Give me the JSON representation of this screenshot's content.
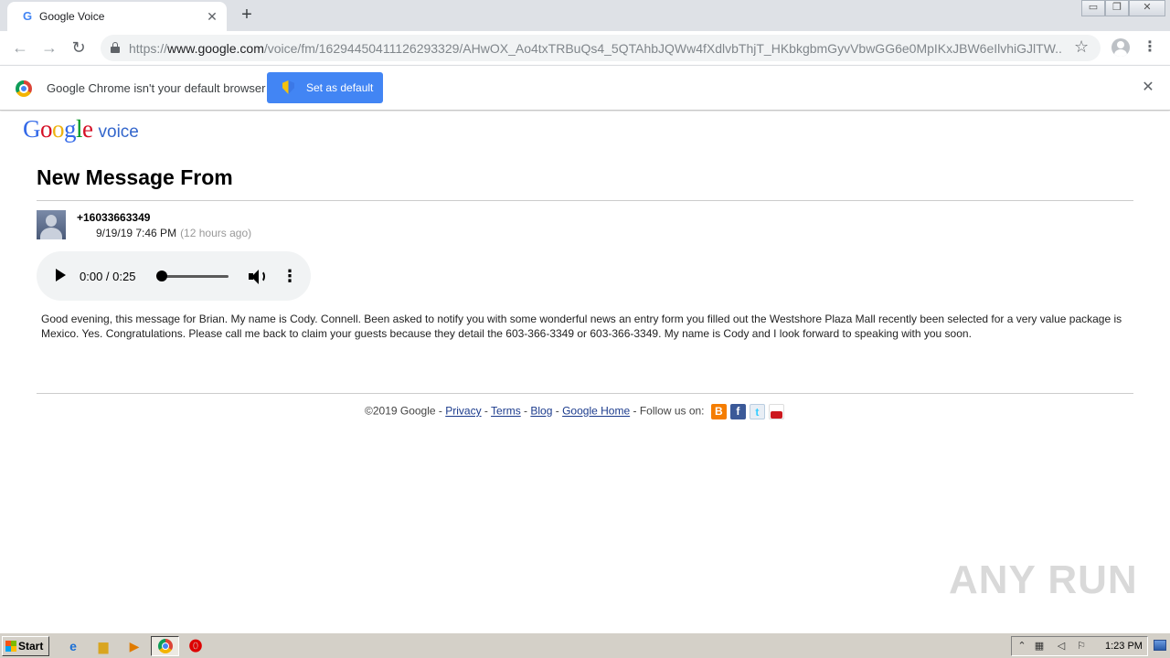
{
  "browser": {
    "tab_title": "Google Voice",
    "tab_favicon": "G",
    "url_scheme": "https://",
    "url_host": "www.google.com",
    "url_path": "/voice/fm/16294450411126293329/AHwOX_Ao4txTRBuQs4_5QTAhbJQWw4fXdlvbThjT_HKbkgbmGyvVbwGG6e0MpIKxJBW6eIlvhiGJlTW...",
    "infobar_message": "Google Chrome isn't your default browser",
    "infobar_button": "Set as default"
  },
  "page": {
    "logo_letters": [
      "G",
      "o",
      "o",
      "g",
      "l",
      "e"
    ],
    "logo_suffix": "voice",
    "title": "New Message From",
    "caller": "+16033663349",
    "datetime": "9/19/19 7:46 PM",
    "relative_time": "(12 hours ago)",
    "audio": {
      "time": "0:00 / 0:25",
      "progress_fraction": 0.0
    },
    "transcript": "Good evening, this message for Brian. My name is Cody. Connell. Been asked to notify you with some wonderful news an entry form you filled out the Westshore Plaza Mall recently been selected for a very value package is Mexico. Yes. Congratulations. Please call me back to claim your guests because they detail the 603-366-3349 or 603-366-3349. My name is Cody and I look forward to speaking with you soon.",
    "footer": {
      "copyright": "©2019 Google",
      "links": [
        "Privacy",
        "Terms",
        "Blog",
        "Google Home"
      ],
      "follow": "Follow us on:",
      "sep": " - "
    }
  },
  "watermark": "ANY RUN",
  "taskbar": {
    "start_label": "Start",
    "clock": "1:23 PM"
  },
  "colors": {
    "chrome_blue": "#4285f4",
    "link": "#1a3a8c",
    "voice_blue": "#3366cc"
  },
  "icons": [
    "google-favicon-icon",
    "lock-icon",
    "star-icon",
    "profile-icon",
    "chrome-logo-icon",
    "shield-icon",
    "avatar-icon",
    "play-icon",
    "volume-icon",
    "blogger-icon",
    "facebook-icon",
    "twitter-icon",
    "youtube-icon"
  ]
}
